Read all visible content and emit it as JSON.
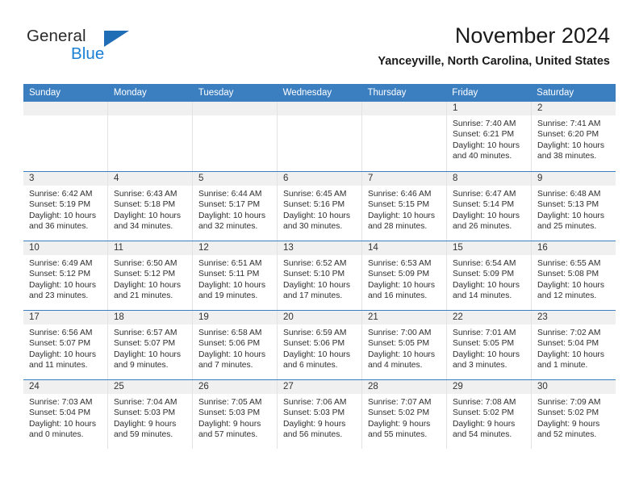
{
  "brand": {
    "word1": "General",
    "word2": "Blue",
    "logo_icon": "triangle-flag-icon",
    "accent_color": "#1f6db5"
  },
  "header": {
    "month_title": "November 2024",
    "location": "Yanceyville, North Carolina, United States"
  },
  "calendar": {
    "header_bg": "#3c7fc1",
    "daynum_bg": "#f0f0f0",
    "weekdays": [
      "Sunday",
      "Monday",
      "Tuesday",
      "Wednesday",
      "Thursday",
      "Friday",
      "Saturday"
    ],
    "weeks": [
      [
        {
          "day": "",
          "empty": true
        },
        {
          "day": "",
          "empty": true
        },
        {
          "day": "",
          "empty": true
        },
        {
          "day": "",
          "empty": true
        },
        {
          "day": "",
          "empty": true
        },
        {
          "day": "1",
          "sunrise": "Sunrise: 7:40 AM",
          "sunset": "Sunset: 6:21 PM",
          "daylight": "Daylight: 10 hours and 40 minutes."
        },
        {
          "day": "2",
          "sunrise": "Sunrise: 7:41 AM",
          "sunset": "Sunset: 6:20 PM",
          "daylight": "Daylight: 10 hours and 38 minutes."
        }
      ],
      [
        {
          "day": "3",
          "sunrise": "Sunrise: 6:42 AM",
          "sunset": "Sunset: 5:19 PM",
          "daylight": "Daylight: 10 hours and 36 minutes."
        },
        {
          "day": "4",
          "sunrise": "Sunrise: 6:43 AM",
          "sunset": "Sunset: 5:18 PM",
          "daylight": "Daylight: 10 hours and 34 minutes."
        },
        {
          "day": "5",
          "sunrise": "Sunrise: 6:44 AM",
          "sunset": "Sunset: 5:17 PM",
          "daylight": "Daylight: 10 hours and 32 minutes."
        },
        {
          "day": "6",
          "sunrise": "Sunrise: 6:45 AM",
          "sunset": "Sunset: 5:16 PM",
          "daylight": "Daylight: 10 hours and 30 minutes."
        },
        {
          "day": "7",
          "sunrise": "Sunrise: 6:46 AM",
          "sunset": "Sunset: 5:15 PM",
          "daylight": "Daylight: 10 hours and 28 minutes."
        },
        {
          "day": "8",
          "sunrise": "Sunrise: 6:47 AM",
          "sunset": "Sunset: 5:14 PM",
          "daylight": "Daylight: 10 hours and 26 minutes."
        },
        {
          "day": "9",
          "sunrise": "Sunrise: 6:48 AM",
          "sunset": "Sunset: 5:13 PM",
          "daylight": "Daylight: 10 hours and 25 minutes."
        }
      ],
      [
        {
          "day": "10",
          "sunrise": "Sunrise: 6:49 AM",
          "sunset": "Sunset: 5:12 PM",
          "daylight": "Daylight: 10 hours and 23 minutes."
        },
        {
          "day": "11",
          "sunrise": "Sunrise: 6:50 AM",
          "sunset": "Sunset: 5:12 PM",
          "daylight": "Daylight: 10 hours and 21 minutes."
        },
        {
          "day": "12",
          "sunrise": "Sunrise: 6:51 AM",
          "sunset": "Sunset: 5:11 PM",
          "daylight": "Daylight: 10 hours and 19 minutes."
        },
        {
          "day": "13",
          "sunrise": "Sunrise: 6:52 AM",
          "sunset": "Sunset: 5:10 PM",
          "daylight": "Daylight: 10 hours and 17 minutes."
        },
        {
          "day": "14",
          "sunrise": "Sunrise: 6:53 AM",
          "sunset": "Sunset: 5:09 PM",
          "daylight": "Daylight: 10 hours and 16 minutes."
        },
        {
          "day": "15",
          "sunrise": "Sunrise: 6:54 AM",
          "sunset": "Sunset: 5:09 PM",
          "daylight": "Daylight: 10 hours and 14 minutes."
        },
        {
          "day": "16",
          "sunrise": "Sunrise: 6:55 AM",
          "sunset": "Sunset: 5:08 PM",
          "daylight": "Daylight: 10 hours and 12 minutes."
        }
      ],
      [
        {
          "day": "17",
          "sunrise": "Sunrise: 6:56 AM",
          "sunset": "Sunset: 5:07 PM",
          "daylight": "Daylight: 10 hours and 11 minutes."
        },
        {
          "day": "18",
          "sunrise": "Sunrise: 6:57 AM",
          "sunset": "Sunset: 5:07 PM",
          "daylight": "Daylight: 10 hours and 9 minutes."
        },
        {
          "day": "19",
          "sunrise": "Sunrise: 6:58 AM",
          "sunset": "Sunset: 5:06 PM",
          "daylight": "Daylight: 10 hours and 7 minutes."
        },
        {
          "day": "20",
          "sunrise": "Sunrise: 6:59 AM",
          "sunset": "Sunset: 5:06 PM",
          "daylight": "Daylight: 10 hours and 6 minutes."
        },
        {
          "day": "21",
          "sunrise": "Sunrise: 7:00 AM",
          "sunset": "Sunset: 5:05 PM",
          "daylight": "Daylight: 10 hours and 4 minutes."
        },
        {
          "day": "22",
          "sunrise": "Sunrise: 7:01 AM",
          "sunset": "Sunset: 5:05 PM",
          "daylight": "Daylight: 10 hours and 3 minutes."
        },
        {
          "day": "23",
          "sunrise": "Sunrise: 7:02 AM",
          "sunset": "Sunset: 5:04 PM",
          "daylight": "Daylight: 10 hours and 1 minute."
        }
      ],
      [
        {
          "day": "24",
          "sunrise": "Sunrise: 7:03 AM",
          "sunset": "Sunset: 5:04 PM",
          "daylight": "Daylight: 10 hours and 0 minutes."
        },
        {
          "day": "25",
          "sunrise": "Sunrise: 7:04 AM",
          "sunset": "Sunset: 5:03 PM",
          "daylight": "Daylight: 9 hours and 59 minutes."
        },
        {
          "day": "26",
          "sunrise": "Sunrise: 7:05 AM",
          "sunset": "Sunset: 5:03 PM",
          "daylight": "Daylight: 9 hours and 57 minutes."
        },
        {
          "day": "27",
          "sunrise": "Sunrise: 7:06 AM",
          "sunset": "Sunset: 5:03 PM",
          "daylight": "Daylight: 9 hours and 56 minutes."
        },
        {
          "day": "28",
          "sunrise": "Sunrise: 7:07 AM",
          "sunset": "Sunset: 5:02 PM",
          "daylight": "Daylight: 9 hours and 55 minutes."
        },
        {
          "day": "29",
          "sunrise": "Sunrise: 7:08 AM",
          "sunset": "Sunset: 5:02 PM",
          "daylight": "Daylight: 9 hours and 54 minutes."
        },
        {
          "day": "30",
          "sunrise": "Sunrise: 7:09 AM",
          "sunset": "Sunset: 5:02 PM",
          "daylight": "Daylight: 9 hours and 52 minutes."
        }
      ]
    ]
  }
}
